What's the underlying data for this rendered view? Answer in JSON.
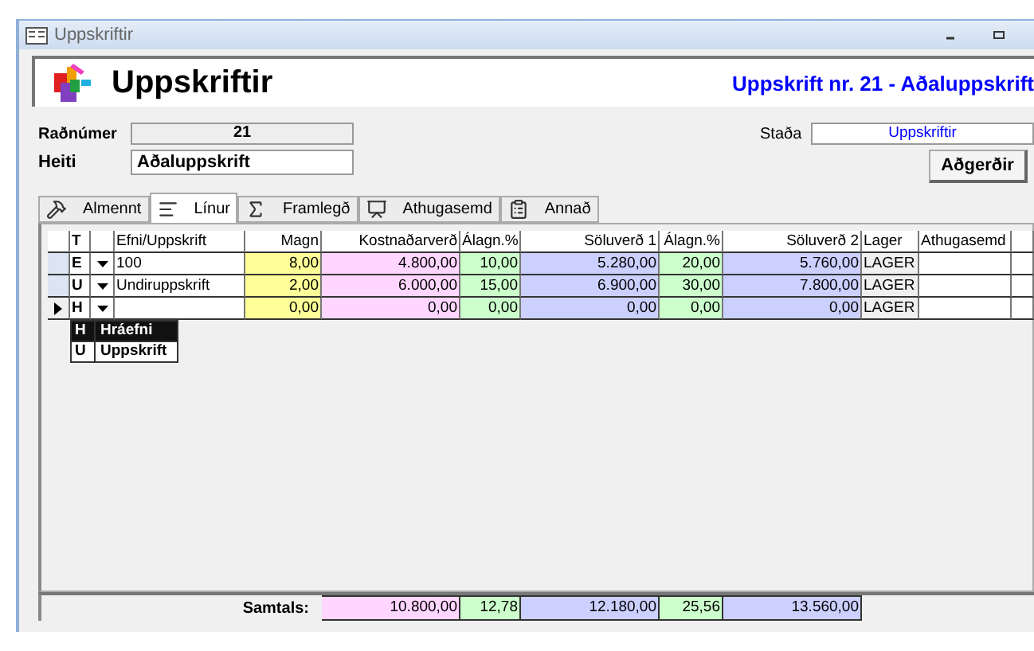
{
  "window": {
    "title": "Uppskriftir"
  },
  "header": {
    "title": "Uppskriftir",
    "subtitle": "Uppskrift nr. 21 - Aðaluppskrift"
  },
  "fields": {
    "number": {
      "label": "Raðnúmer",
      "value": "21"
    },
    "name": {
      "label": "Heiti",
      "value": "Aðaluppskrift"
    },
    "status": {
      "label": "Staða",
      "value": "Uppskriftir"
    }
  },
  "actions_button": "Aðgerðir",
  "tabs": [
    {
      "label": "Almennt",
      "selected": false,
      "kind": "tools"
    },
    {
      "label": "Línur",
      "selected": true,
      "kind": "lines"
    },
    {
      "label": "Framlegð",
      "selected": false,
      "kind": "sum"
    },
    {
      "label": "Athugasemd",
      "selected": false,
      "kind": "note"
    },
    {
      "label": "Annað",
      "selected": false,
      "kind": "other"
    }
  ],
  "table": {
    "columns": [
      {
        "label": "T",
        "kind": "type"
      },
      {
        "kind": "picker"
      },
      {
        "label": "Efni/Uppskrift",
        "kind": "item"
      },
      {
        "label": "Magn",
        "kind": "number",
        "color": "#ffff99"
      },
      {
        "label": "Kostnaðarverð",
        "kind": "number",
        "color": "#ffd6ff"
      },
      {
        "label": "Álagn.%",
        "kind": "number",
        "color": "#ccffcc"
      },
      {
        "label": "Söluverð 1",
        "kind": "number",
        "color": "#ccd0ff"
      },
      {
        "label": "Álagn.%",
        "kind": "number",
        "color": "#ccffcc"
      },
      {
        "label": "Söluverð 2",
        "kind": "number",
        "color": "#ccd0ff"
      },
      {
        "label": "Lager",
        "kind": "stock"
      },
      {
        "label": "Athugasemd",
        "kind": "note"
      }
    ],
    "rows": [
      {
        "current": false,
        "type": "E",
        "item": "100",
        "values": [
          "8,00",
          "4.800,00",
          "10,00",
          "5.280,00",
          "20,00",
          "5.760,00"
        ],
        "stock": "LAGER"
      },
      {
        "current": false,
        "type": "U",
        "item": "Undiruppskrift",
        "values": [
          "2,00",
          "6.000,00",
          "15,00",
          "6.900,00",
          "30,00",
          "7.800,00"
        ],
        "stock": "LAGER"
      },
      {
        "current": true,
        "type": "H",
        "values": [
          "0,00",
          "0,00",
          "0,00",
          "0,00",
          "0,00",
          "0,00"
        ],
        "stock": "LAGER"
      }
    ],
    "type_dropdown": [
      {
        "code": "H",
        "label": "Hráefni",
        "selected": true
      },
      {
        "code": "U",
        "label": "Uppskrift",
        "selected": false
      }
    ]
  },
  "totals": {
    "label": "Samtals:",
    "cells": [
      {
        "value": "10.800,00",
        "color": "#ffd6ff"
      },
      {
        "value": "12,78",
        "color": "#ccffcc"
      },
      {
        "value": "12.180,00",
        "color": "#ccd0ff"
      },
      {
        "value": "25,56",
        "color": "#ccffcc"
      },
      {
        "value": "13.560,00",
        "color": "#ccd0ff"
      }
    ]
  }
}
